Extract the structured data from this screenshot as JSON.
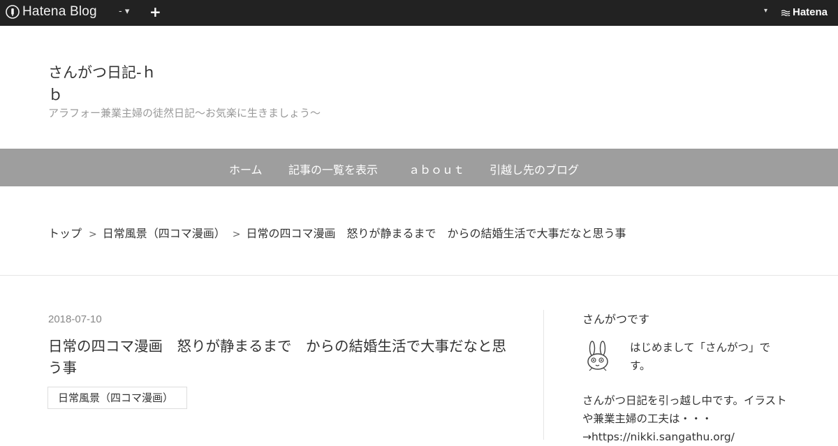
{
  "topbar": {
    "brand": "Hatena Blog",
    "menu_label": "- ▾",
    "plus_label": "+",
    "right_caret": "▾",
    "hatena_label": "Hatena",
    "colors": {
      "background": "#222222"
    }
  },
  "header": {
    "title": "さんがつ日記-ｈｂ",
    "description": "アラフォー兼業主婦の徒然日記〜お気楽に生きましょう〜"
  },
  "nav": {
    "items": [
      {
        "label": "ホーム"
      },
      {
        "label": "記事の一覧を表示"
      },
      {
        "label": "ａｂｏｕｔ"
      },
      {
        "label": "引越し先のブログ"
      }
    ],
    "colors": {
      "background": "#9e9e9e"
    }
  },
  "breadcrumb": {
    "items": [
      {
        "label": "トップ"
      },
      {
        "label": "日常風景（四コマ漫画）"
      },
      {
        "label": "日常の四コマ漫画　怒りが静まるまで　からの結婚生活で大事だなと思う事"
      }
    ],
    "separator": ">"
  },
  "article": {
    "date": "2018-07-10",
    "title": "日常の四コマ漫画　怒りが静まるまで　からの結婚生活で大事だなと思う事",
    "category": "日常風景（四コマ漫画）"
  },
  "sidebar": {
    "title": "さんがつです",
    "avatar_icon": "rabbit-avatar-icon",
    "intro": "はじめまして「さんがつ」です。",
    "body": "さんがつ日記を引っ越し中です。イラストや兼業主婦の工夫は・・・",
    "link": "→https://nikki.sangathu.org/"
  }
}
